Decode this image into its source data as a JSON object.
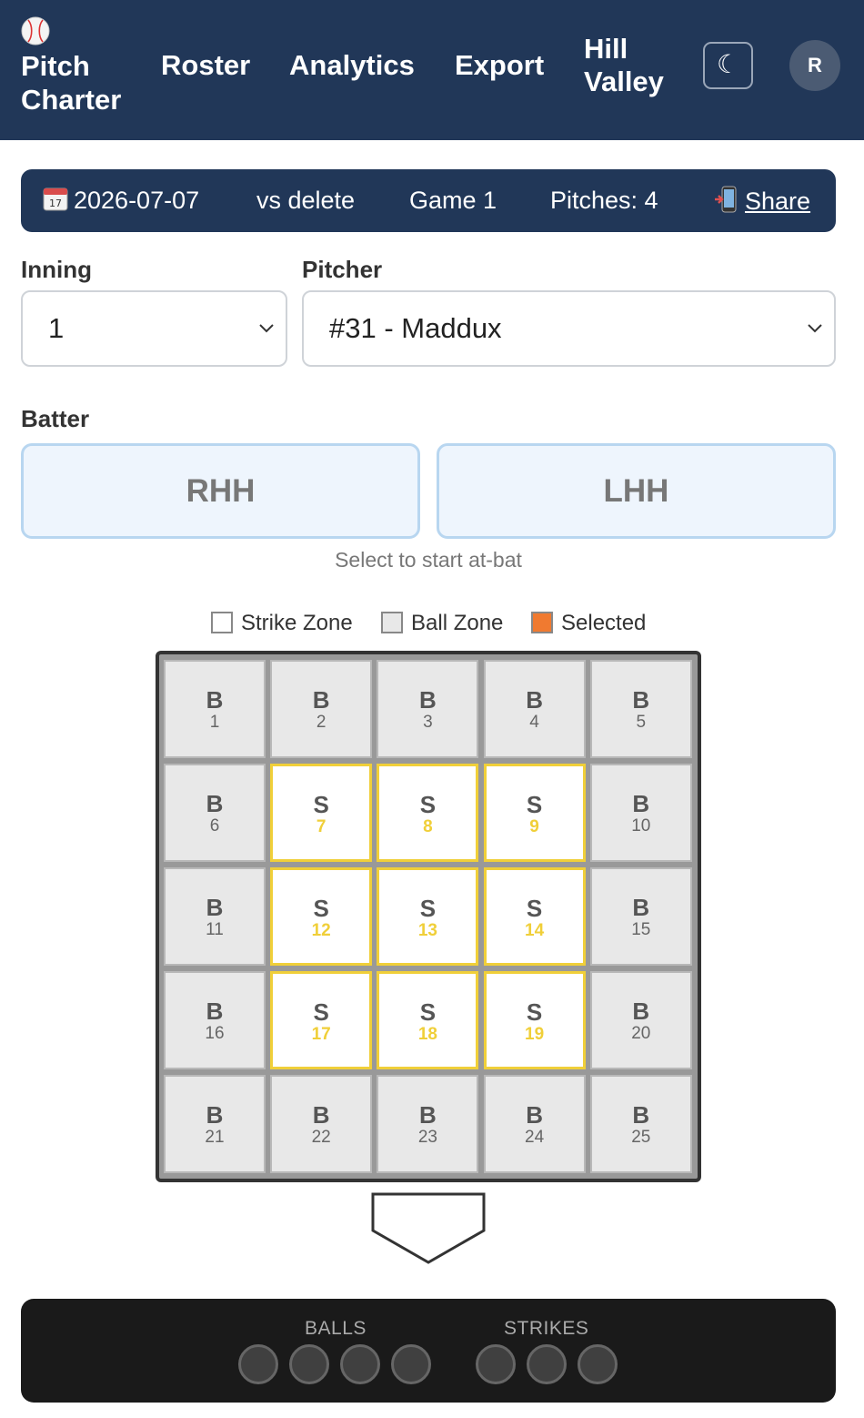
{
  "header": {
    "brand": "Pitch Charter",
    "nav": [
      "Roster",
      "Analytics",
      "Export"
    ],
    "team": "Hill Valley",
    "theme_icon": "☾",
    "avatar_initial": "R"
  },
  "game": {
    "date": "2026-07-07",
    "opponent": "vs delete",
    "game_label": "Game 1",
    "pitches": "Pitches: 4",
    "share": "Share"
  },
  "inning": {
    "label": "Inning",
    "value": "1"
  },
  "pitcher": {
    "label": "Pitcher",
    "value": "#31 - Maddux"
  },
  "batter": {
    "label": "Batter",
    "options": [
      "RHH",
      "LHH"
    ],
    "hint": "Select to start at-bat"
  },
  "legend": [
    {
      "label": "Strike Zone",
      "color": "#ffffff"
    },
    {
      "label": "Ball Zone",
      "color": "#e8e8e8"
    },
    {
      "label": "Selected",
      "color": "#f07a30"
    }
  ],
  "zones": [
    {
      "t": "B",
      "n": "1"
    },
    {
      "t": "B",
      "n": "2"
    },
    {
      "t": "B",
      "n": "3"
    },
    {
      "t": "B",
      "n": "4"
    },
    {
      "t": "B",
      "n": "5"
    },
    {
      "t": "B",
      "n": "6"
    },
    {
      "t": "S",
      "n": "7"
    },
    {
      "t": "S",
      "n": "8"
    },
    {
      "t": "S",
      "n": "9"
    },
    {
      "t": "B",
      "n": "10"
    },
    {
      "t": "B",
      "n": "11"
    },
    {
      "t": "S",
      "n": "12"
    },
    {
      "t": "S",
      "n": "13"
    },
    {
      "t": "S",
      "n": "14"
    },
    {
      "t": "B",
      "n": "15"
    },
    {
      "t": "B",
      "n": "16"
    },
    {
      "t": "S",
      "n": "17"
    },
    {
      "t": "S",
      "n": "18"
    },
    {
      "t": "S",
      "n": "19"
    },
    {
      "t": "B",
      "n": "20"
    },
    {
      "t": "B",
      "n": "21"
    },
    {
      "t": "B",
      "n": "22"
    },
    {
      "t": "B",
      "n": "23"
    },
    {
      "t": "B",
      "n": "24"
    },
    {
      "t": "B",
      "n": "25"
    }
  ],
  "count": {
    "balls_label": "BALLS",
    "strikes_label": "STRIKES",
    "balls": 0,
    "balls_max": 4,
    "strikes": 0,
    "strikes_max": 3
  },
  "colors": {
    "navy": "#213758",
    "strike_border": "#f0cf39",
    "selected": "#f07a30"
  }
}
